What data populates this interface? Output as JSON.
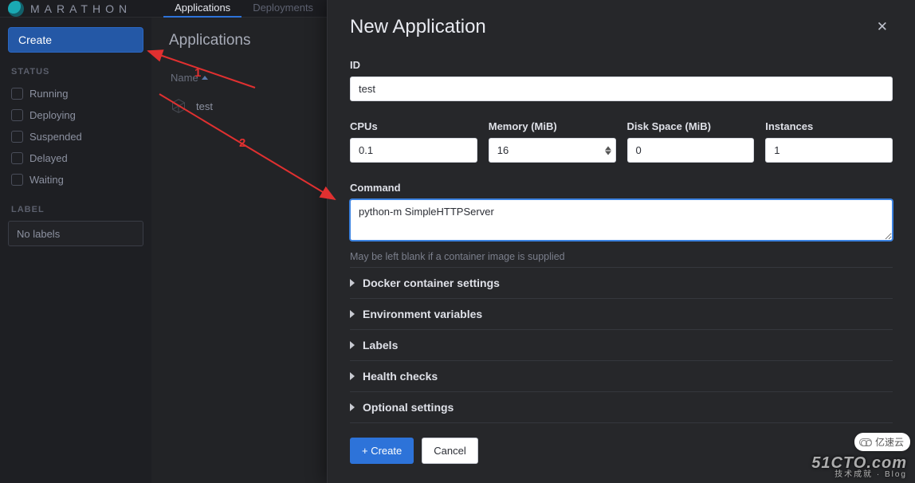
{
  "topbar": {
    "brand": "MARATHON",
    "tabs": [
      {
        "label": "Applications",
        "active": true
      },
      {
        "label": "Deployments",
        "active": false
      }
    ]
  },
  "sidebar": {
    "create_label": "Create",
    "status_header": "STATUS",
    "statuses": [
      "Running",
      "Deploying",
      "Suspended",
      "Delayed",
      "Waiting"
    ],
    "label_header": "LABEL",
    "no_labels": "No labels"
  },
  "main": {
    "title": "Applications",
    "name_col": "Name",
    "app_row_name": "test"
  },
  "modal": {
    "title": "New Application",
    "id_label": "ID",
    "id_value": "test",
    "cpus_label": "CPUs",
    "cpus_value": "0.1",
    "mem_label": "Memory (MiB)",
    "mem_value": "16",
    "disk_label": "Disk Space (MiB)",
    "disk_value": "0",
    "inst_label": "Instances",
    "inst_value": "1",
    "cmd_label": "Command",
    "cmd_value": "python-m SimpleHTTPServer",
    "cmd_hint": "May be left blank if a container image is supplied",
    "accordion": [
      "Docker container settings",
      "Environment variables",
      "Labels",
      "Health checks",
      "Optional settings"
    ],
    "create_btn": "+ Create",
    "cancel_btn": "Cancel"
  },
  "annotations": {
    "n1": "1",
    "n2": "2"
  },
  "watermark": {
    "site": "51CTO.com",
    "sub": "技术成就 · Blog",
    "pill": "亿速云"
  }
}
